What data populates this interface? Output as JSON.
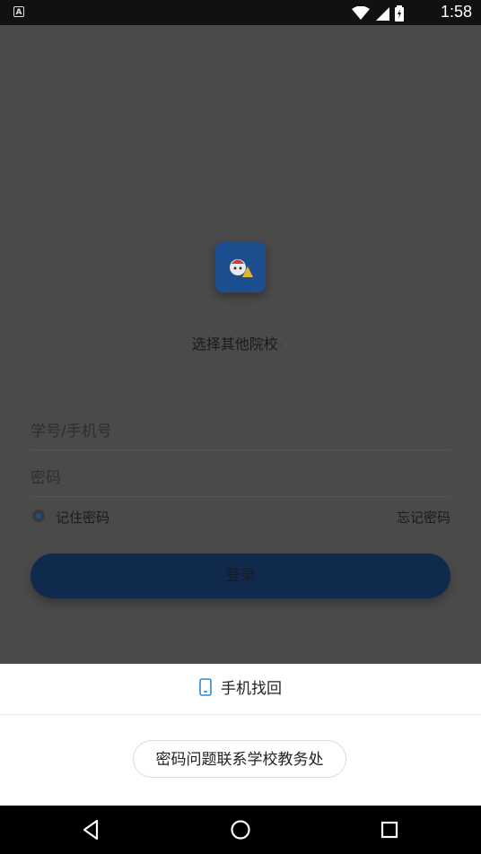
{
  "status_bar": {
    "time": "1:58",
    "left_icon_letter": "A",
    "icons": [
      "wifi-icon",
      "signal-icon",
      "battery-icon"
    ]
  },
  "login": {
    "school_selector_label": "选择其他院校",
    "account_placeholder": "学号/手机号",
    "password_placeholder": "密码",
    "remember_label": "记住密码",
    "forgot_label": "忘记密码",
    "login_button_label": "登录"
  },
  "sheet": {
    "phone_recovery_label": "手机找回",
    "contact_school_label": "密码问题联系学校教务处"
  },
  "colors": {
    "accent": "#1d4e8f",
    "dim_overlay": "#4a4a4a",
    "phone_icon": "#2a8bd8"
  }
}
